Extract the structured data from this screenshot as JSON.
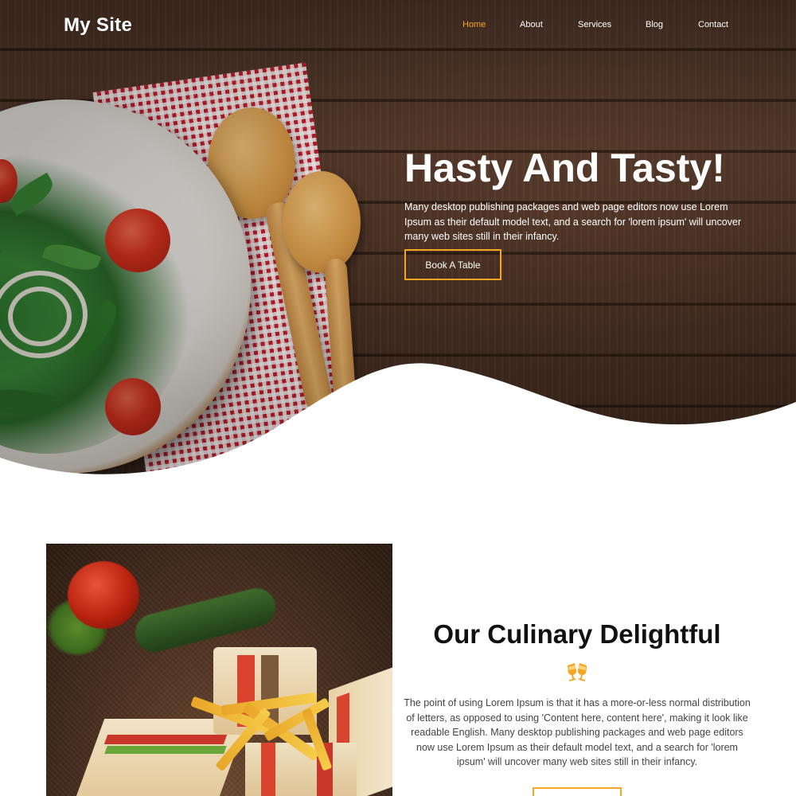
{
  "header": {
    "logo": "My Site",
    "nav": [
      {
        "label": "Home",
        "active": true
      },
      {
        "label": "About",
        "active": false
      },
      {
        "label": "Services",
        "active": false
      },
      {
        "label": "Blog",
        "active": false
      },
      {
        "label": "Contact",
        "active": false
      }
    ]
  },
  "hero": {
    "title": "Hasty And Tasty!",
    "text": "Many desktop publishing packages and web page editors now use Lorem Ipsum as their default model text, and a search for 'lorem ipsum' will uncover many web sites still in their infancy.",
    "button_label": "Book A Table"
  },
  "section": {
    "title": "Our Culinary Delightful",
    "icon": "cheers-icon",
    "text": "The point of using Lorem Ipsum is that it has a more-or-less normal distribution of letters, as opposed to using 'Content here, content here', making it look like readable English. Many desktop publishing packages and web page editors now use Lorem Ipsum as their default model text, and a search for 'lorem ipsum' will uncover many web sites still in their infancy."
  },
  "colors": {
    "accent": "#f5a623",
    "hero_text": "#ffffff",
    "section_title": "#111111",
    "body_text": "#444444"
  }
}
